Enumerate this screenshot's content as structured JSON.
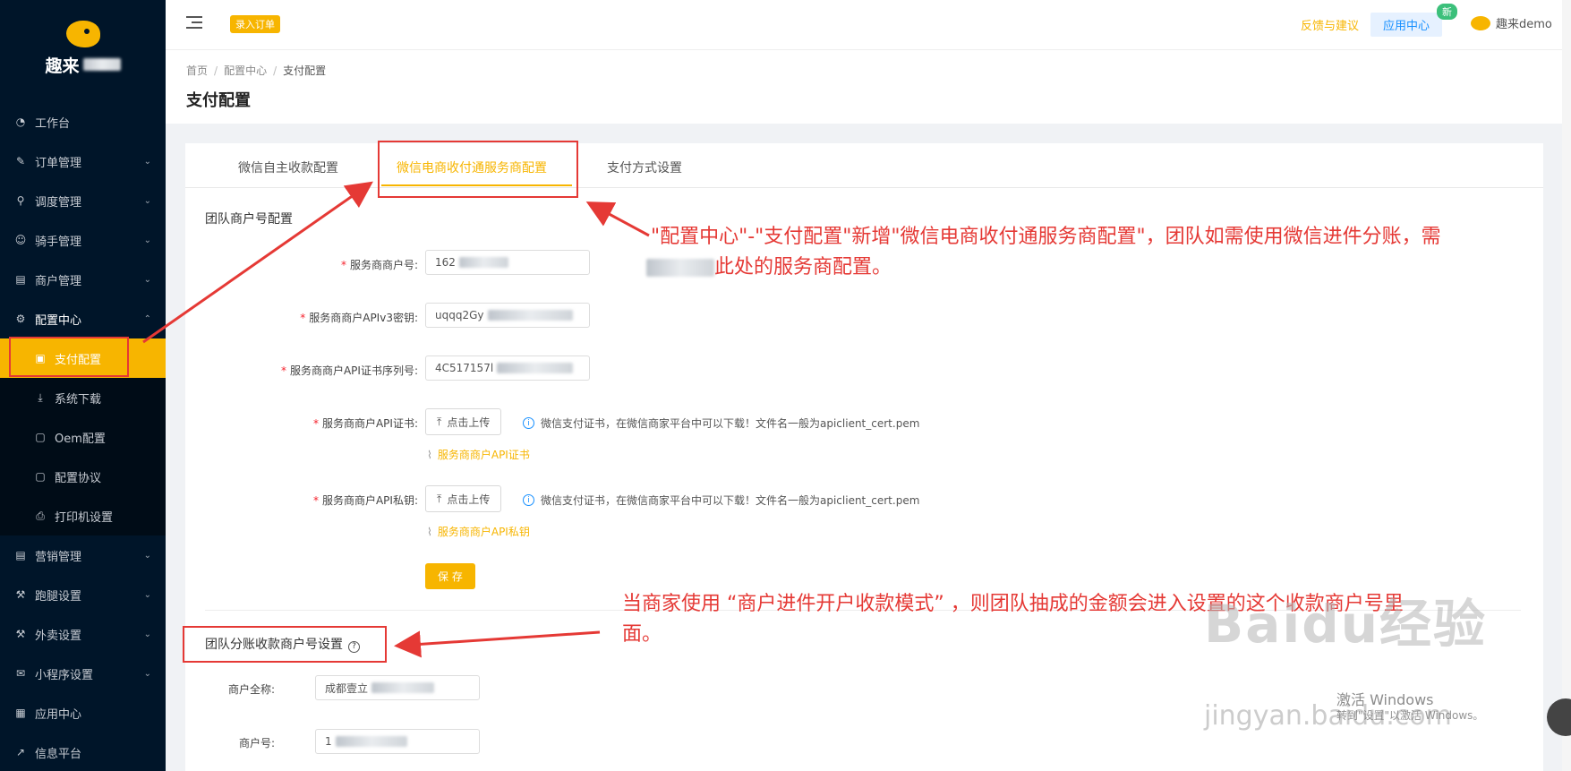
{
  "sidebar": {
    "brand_prefix": "趣来",
    "items": [
      {
        "label": "工作台",
        "icon": "dashboard-icon"
      },
      {
        "label": "订单管理",
        "icon": "edit-icon"
      },
      {
        "label": "调度管理",
        "icon": "user-icon"
      },
      {
        "label": "骑手管理",
        "icon": "rider-icon"
      },
      {
        "label": "商户管理",
        "icon": "store-icon"
      },
      {
        "label": "配置中心",
        "icon": "gear-icon"
      }
    ],
    "sub_items": [
      {
        "label": "支付配置",
        "icon": "doc-icon"
      },
      {
        "label": "系统下载",
        "icon": "download-icon"
      },
      {
        "label": "Oem配置",
        "icon": "file-icon"
      },
      {
        "label": "配置协议",
        "icon": "file-icon"
      },
      {
        "label": "打印机设置",
        "icon": "printer-icon"
      }
    ],
    "items_after": [
      {
        "label": "营销管理",
        "icon": "marketing-icon"
      },
      {
        "label": "跑腿设置",
        "icon": "wrench-icon"
      },
      {
        "label": "外卖设置",
        "icon": "wrench-icon"
      },
      {
        "label": "小程序设置",
        "icon": "wechat-icon"
      },
      {
        "label": "应用中心",
        "icon": "app-icon"
      },
      {
        "label": "信息平台",
        "icon": "chart-icon"
      }
    ]
  },
  "topbar": {
    "order_button": "录入订单",
    "feedback": "反馈与建议",
    "app_center": "应用中心",
    "new_badge": "新",
    "username": "趣来demo"
  },
  "breadcrumb": [
    "首页",
    "配置中心",
    "支付配置"
  ],
  "page_title": "支付配置",
  "tabs": [
    "微信自主收款配置",
    "微信电商收付通服务商配置",
    "支付方式设置"
  ],
  "active_tab": 1,
  "section1": {
    "title": "团队商户号配置",
    "fields": [
      {
        "label": "服务商商户号:",
        "value": "162"
      },
      {
        "label": "服务商商户APIv3密钥:",
        "value": "uqqq2Gy"
      },
      {
        "label": "服务商商户API证书序列号:",
        "value": "4C517157l"
      }
    ],
    "uploads": [
      {
        "label": "服务商商户API证书:",
        "button": "点击上传",
        "hint": "微信支付证书，在微信商家平台中可以下载！文件名一般为apiclient_cert.pem",
        "file": "服务商商户API证书"
      },
      {
        "label": "服务商商户API私钥:",
        "button": "点击上传",
        "hint": "微信支付证书，在微信商家平台中可以下载！文件名一般为apiclient_cert.pem",
        "file": "服务商商户API私钥"
      }
    ],
    "save": "保 存"
  },
  "section2": {
    "title": "团队分账收款商户号设置",
    "fields": [
      {
        "label": "商户全称:",
        "value": "成都壹立"
      },
      {
        "label": "商户号:",
        "value": "1"
      }
    ]
  },
  "annotations": {
    "top_line1": "\"配置中心\"-\"支付配置\"新增\"微信电商收付通服务商配置\"，团队如需使用微信进件分账，需",
    "top_line2": "此处的服务商配置。",
    "bottom_line1": "当商家使用 “商户进件开户收款模式” ，则团队抽成的金额会进入设置的这个收款商户号里",
    "bottom_line2": "面。",
    "color": "#e53935"
  },
  "overlay": {
    "watermark": "Baidu经验",
    "watermark_sub": "jingyan.baidu.com",
    "win_activate": "激活 Windows",
    "win_activate_sub": "转到\"设置\"以激活 Windows。"
  }
}
